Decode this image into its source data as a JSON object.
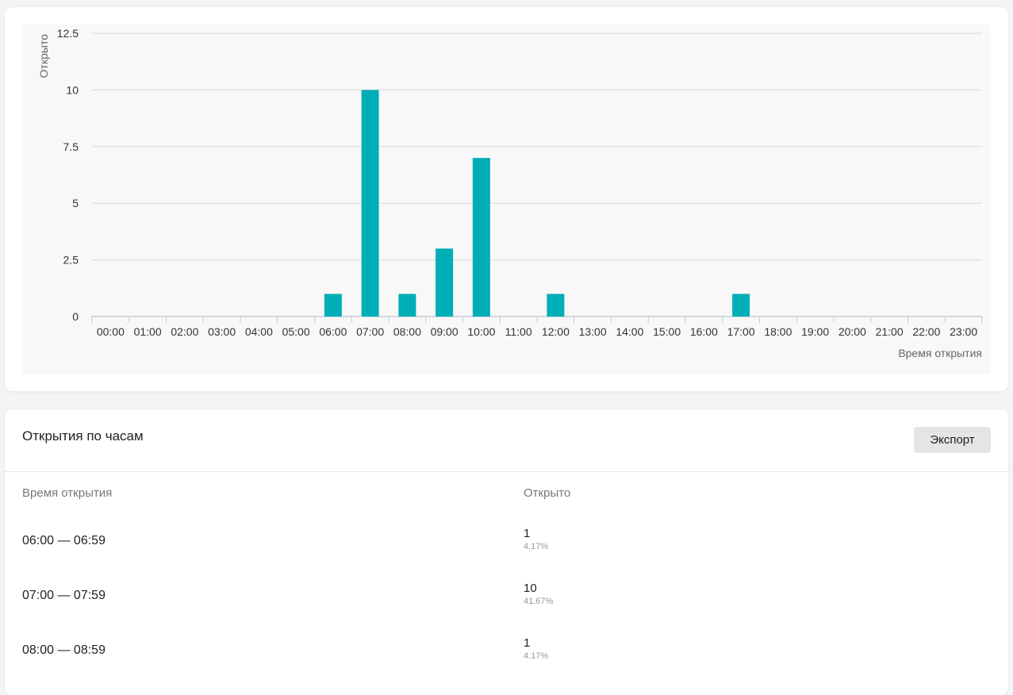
{
  "chart_data": {
    "type": "bar",
    "categories": [
      "00:00",
      "01:00",
      "02:00",
      "03:00",
      "04:00",
      "05:00",
      "06:00",
      "07:00",
      "08:00",
      "09:00",
      "10:00",
      "11:00",
      "12:00",
      "13:00",
      "14:00",
      "15:00",
      "16:00",
      "17:00",
      "18:00",
      "19:00",
      "20:00",
      "21:00",
      "22:00",
      "23:00"
    ],
    "values": [
      0,
      0,
      0,
      0,
      0,
      0,
      1,
      10,
      1,
      3,
      7,
      0,
      1,
      0,
      0,
      0,
      0,
      1,
      0,
      0,
      0,
      0,
      0,
      0
    ],
    "xlabel": "Время открытия",
    "ylabel": "Открыто",
    "ylim": [
      0,
      12.5
    ],
    "yticks": [
      "0",
      "2.5",
      "5",
      "7.5",
      "10",
      "12.5"
    ],
    "grid": true,
    "bar_color": "#00aeb7"
  },
  "table": {
    "title": "Открытия по часам",
    "export_label": "Экспорт",
    "columns": [
      "Время открытия",
      "Открыто"
    ],
    "rows": [
      {
        "time": "06:00 — 06:59",
        "count": "1",
        "percent": "4.17%"
      },
      {
        "time": "07:00 — 07:59",
        "count": "10",
        "percent": "41.67%"
      },
      {
        "time": "08:00 — 08:59",
        "count": "1",
        "percent": "4.17%"
      }
    ]
  }
}
